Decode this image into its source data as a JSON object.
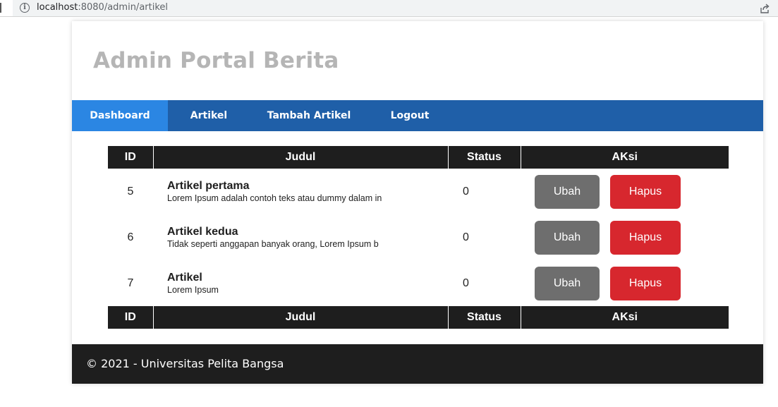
{
  "browser": {
    "url_host": "localhost",
    "url_rest": ":8080/admin/artikel"
  },
  "header": {
    "title": "Admin Portal Berita"
  },
  "nav": {
    "items": [
      {
        "label": "Dashboard",
        "active": true
      },
      {
        "label": "Artikel",
        "active": false
      },
      {
        "label": "Tambah Artikel",
        "active": false
      },
      {
        "label": "Logout",
        "active": false
      }
    ]
  },
  "table": {
    "columns": [
      "ID",
      "Judul",
      "Status",
      "AKsi"
    ],
    "rows": [
      {
        "id": "5",
        "title": "Artikel pertama",
        "desc": "Lorem Ipsum adalah contoh teks atau dummy dalam in",
        "status": "0",
        "edit_label": "Ubah",
        "delete_label": "Hapus"
      },
      {
        "id": "6",
        "title": "Artikel kedua",
        "desc": "Tidak seperti anggapan banyak orang, Lorem Ipsum b",
        "status": "0",
        "edit_label": "Ubah",
        "delete_label": "Hapus"
      },
      {
        "id": "7",
        "title": "Artikel",
        "desc": "Lorem Ipsum",
        "status": "0",
        "edit_label": "Ubah",
        "delete_label": "Hapus"
      }
    ]
  },
  "footer": {
    "text": "© 2021 - Universitas Pelita Bangsa"
  },
  "colors": {
    "nav_bg": "#1f5fa8",
    "nav_active": "#2b86e3",
    "table_header": "#1e1e1e",
    "btn_edit": "#6e6e6e",
    "btn_delete": "#d7272e",
    "footer_bg": "#1e1e1e",
    "title_color": "#b5b5b5"
  },
  "icons": [
    "info-icon",
    "share-icon"
  ]
}
